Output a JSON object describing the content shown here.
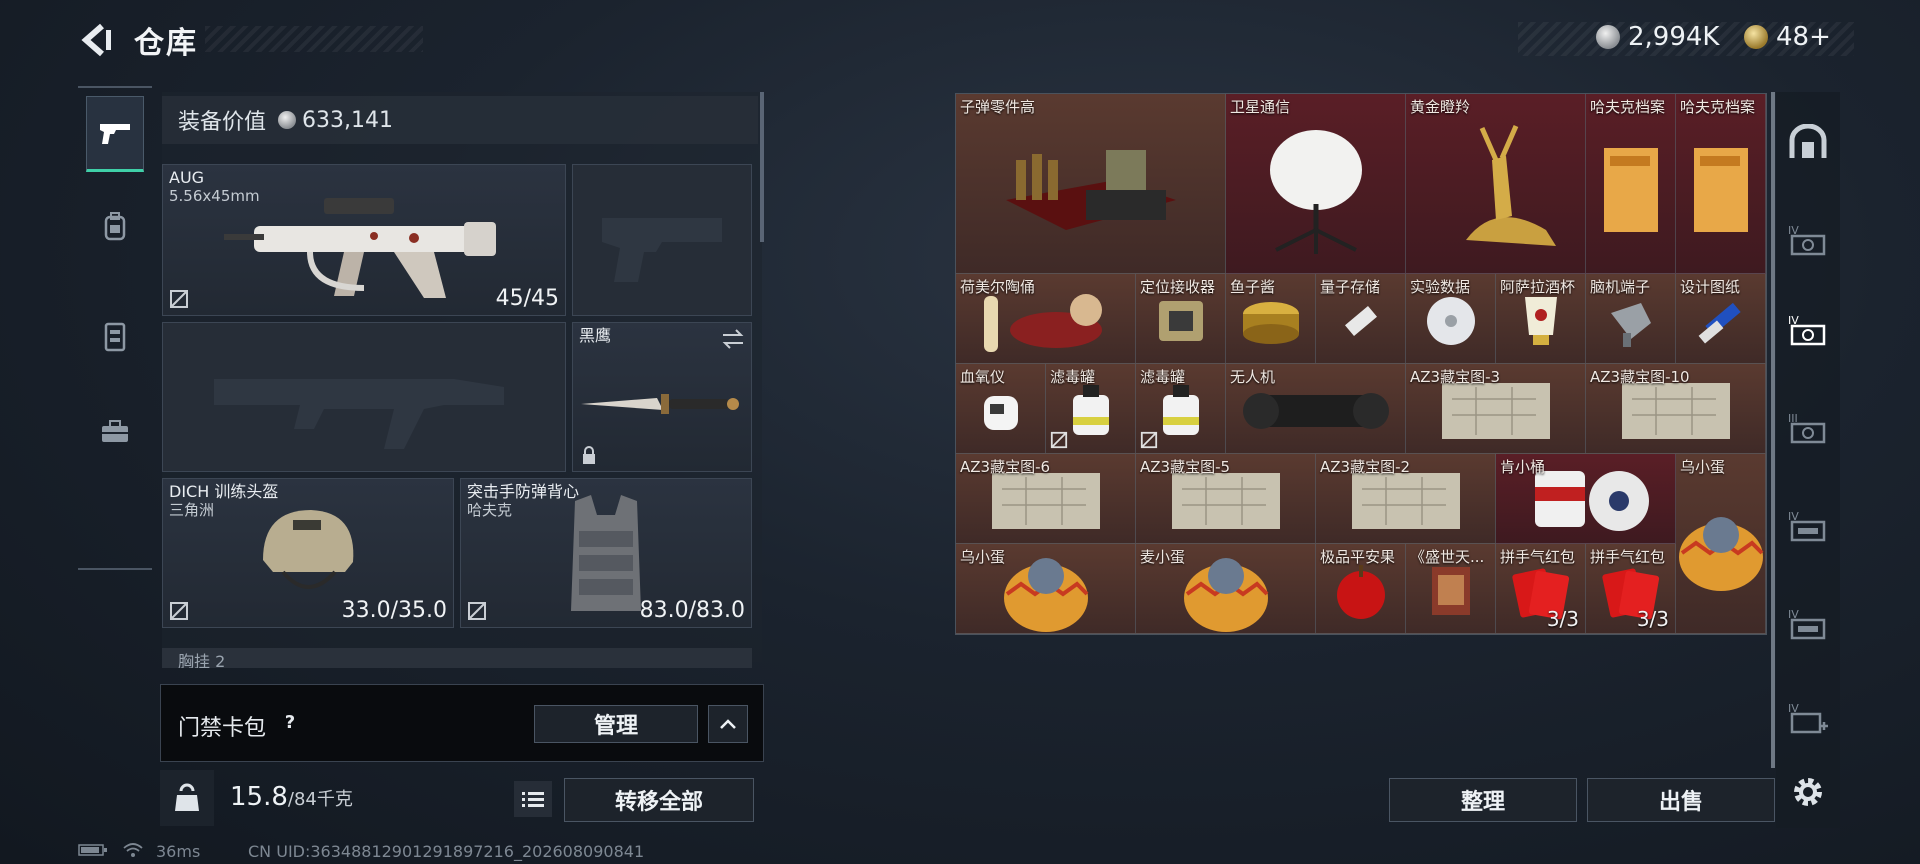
{
  "header": {
    "title": "仓库",
    "currency_silver": "2,994K",
    "currency_gold": "48+"
  },
  "left_tabs": [
    "weapon-icon",
    "backpack-icon",
    "armor-vest-icon",
    "briefcase-icon"
  ],
  "loadout": {
    "value_label": "装备价值",
    "value": "633,141",
    "primary": {
      "name": "AUG",
      "caliber": "5.56x45mm",
      "ammo": "45/45"
    },
    "melee": {
      "name": "黑鹰"
    },
    "helmet": {
      "name": "DICH 训练头盔",
      "sub": "三角洲",
      "durability": "33.0/35.0"
    },
    "vest": {
      "name": "突击手防弹背心",
      "sub": "哈夫克",
      "durability": "83.0/83.0"
    },
    "next_slot_label": "胸挂 2"
  },
  "keycard": {
    "label": "门禁卡包",
    "help": "?",
    "manage_button": "管理"
  },
  "weight": {
    "icon_label": "KG",
    "current": "15.8",
    "max": "/84千克"
  },
  "transfer_all_button": "转移全部",
  "status_bar": {
    "ping": "36ms",
    "uid": "CN UID:36348812901291897216_202608090841"
  },
  "stash_items": [
    {
      "label": "子弹零件高",
      "count": ""
    },
    {
      "label": "卫星通信",
      "count": ""
    },
    {
      "label": "黄金瞪羚",
      "count": ""
    },
    {
      "label": "哈夫克档案",
      "count": ""
    },
    {
      "label": "哈夫克档案",
      "count": ""
    },
    {
      "label": "荷美尔陶俑",
      "count": ""
    },
    {
      "label": "定位接收器",
      "count": ""
    },
    {
      "label": "鱼子酱",
      "count": ""
    },
    {
      "label": "量子存储",
      "count": ""
    },
    {
      "label": "实验数据",
      "count": ""
    },
    {
      "label": "阿萨拉酒杯",
      "count": ""
    },
    {
      "label": "脑机端子",
      "count": ""
    },
    {
      "label": "设计图纸",
      "count": ""
    },
    {
      "label": "血氧仪",
      "count": ""
    },
    {
      "label": "滤毒罐",
      "count": ""
    },
    {
      "label": "滤毒罐",
      "count": ""
    },
    {
      "label": "无人机",
      "count": ""
    },
    {
      "label": "AZ3藏宝图-3",
      "count": ""
    },
    {
      "label": "AZ3藏宝图-10",
      "count": ""
    },
    {
      "label": "AZ3藏宝图-6",
      "count": ""
    },
    {
      "label": "AZ3藏宝图-5",
      "count": ""
    },
    {
      "label": "AZ3藏宝图-2",
      "count": ""
    },
    {
      "label": "肯小桶",
      "count": ""
    },
    {
      "label": "乌小蛋",
      "count": ""
    },
    {
      "label": "乌小蛋",
      "count": ""
    },
    {
      "label": "麦小蛋",
      "count": ""
    },
    {
      "label": "极品平安果",
      "count": ""
    },
    {
      "label": "《盛世天...",
      "count": ""
    },
    {
      "label": "拼手气红包",
      "count": "3/3"
    },
    {
      "label": "拼手气红包",
      "count": "3/3"
    }
  ],
  "right_tabs": [
    "home-shelter-icon",
    "IV",
    "IV",
    "III",
    "IV",
    "IV",
    "IV"
  ],
  "actions": {
    "sort_button": "整理",
    "sell_button": "出售"
  },
  "colors": {
    "accent": "#3fd0a8",
    "gold_rarity": "#5a3a30",
    "red_rarity": "#5a1e26",
    "purple_rarity": "#4a2a36"
  }
}
